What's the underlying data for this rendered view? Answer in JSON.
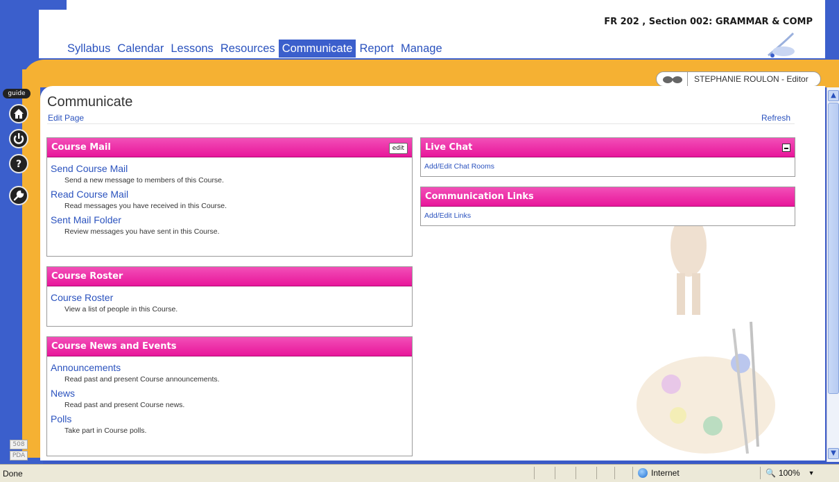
{
  "header": {
    "course_title": "FR 202 , Section 002: GRAMMAR & COMP",
    "nav": [
      {
        "label": "Syllabus",
        "active": false
      },
      {
        "label": "Calendar",
        "active": false
      },
      {
        "label": "Lessons",
        "active": false
      },
      {
        "label": "Resources",
        "active": false
      },
      {
        "label": "Communicate",
        "active": true
      },
      {
        "label": "Report",
        "active": false
      },
      {
        "label": "Manage",
        "active": false
      }
    ]
  },
  "user": {
    "name": "STEPHANIE ROULON - Editor",
    "icon": "glasses-icon"
  },
  "rail": {
    "guide_label": "guide",
    "buttons": [
      {
        "name": "home-icon"
      },
      {
        "name": "power-icon"
      },
      {
        "name": "help-icon"
      },
      {
        "name": "wrench-icon"
      }
    ],
    "mode_508": "508",
    "mode_pda": "PDA"
  },
  "page": {
    "title": "Communicate",
    "edit_page": "Edit Page",
    "refresh": "Refresh"
  },
  "course_mail": {
    "title": "Course Mail",
    "edit_label": "edit",
    "items": [
      {
        "link": "Send Course Mail",
        "desc": "Send a new message to members of this Course."
      },
      {
        "link": "Read Course Mail",
        "desc": "Read messages you have received in this Course."
      },
      {
        "link": "Sent Mail Folder",
        "desc": "Review messages you have sent in this Course."
      }
    ]
  },
  "course_roster": {
    "title": "Course Roster",
    "items": [
      {
        "link": "Course Roster",
        "desc": "View a list of people in this Course."
      }
    ]
  },
  "news_events": {
    "title": "Course News and Events",
    "items": [
      {
        "link": "Announcements",
        "desc": "Read past and present Course announcements."
      },
      {
        "link": "News",
        "desc": "Read past and present Course news."
      },
      {
        "link": "Polls",
        "desc": "Take part in Course polls."
      }
    ]
  },
  "live_chat": {
    "title": "Live Chat",
    "link": "Add/Edit Chat Rooms"
  },
  "communication_links": {
    "title": "Communication Links",
    "link": "Add/Edit Links"
  },
  "statusbar": {
    "status": "Done",
    "zone": "Internet",
    "zoom": "100%"
  },
  "colors": {
    "brand_blue": "#3b5fcc",
    "accent_orange": "#f5b133",
    "box_header_pink": "#e8169a",
    "link_blue": "#2a52be"
  }
}
